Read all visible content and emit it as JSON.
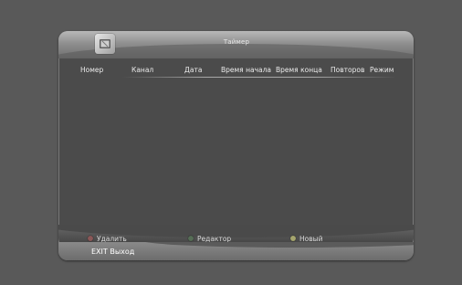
{
  "header": {
    "title": "Таймер",
    "icon": "timer-icon"
  },
  "columns": [
    "Номер",
    "Канал",
    "Дата",
    "Время начала",
    "Время конца",
    "Повторов",
    "Режим"
  ],
  "footer": {
    "buttons": [
      {
        "label": "Удалить",
        "color": "#8a5858"
      },
      {
        "label": "Редактор",
        "color": "#566d56"
      },
      {
        "label": "Новый",
        "color": "#a5a56e"
      }
    ],
    "exit_label": "EXIT Выход"
  }
}
